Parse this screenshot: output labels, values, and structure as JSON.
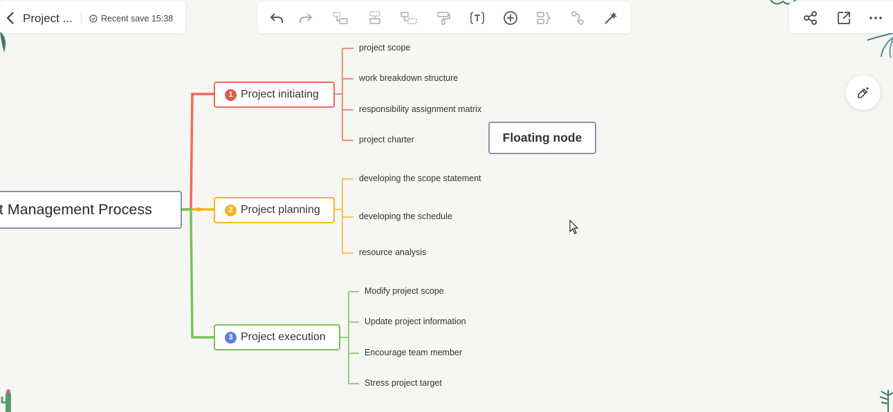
{
  "header": {
    "back_icon": "chevron-left-icon",
    "title": "Project ...",
    "save_status": "Recent save 15:38",
    "save_icon": "check-circle-icon"
  },
  "toolbar": {
    "icons": [
      "undo-icon",
      "redo-icon",
      "insert-topic-icon",
      "insert-subtopic-icon",
      "insert-floating-topic-icon",
      "format-painter-icon",
      "text-icon",
      "add-icon",
      "summary-icon",
      "relationship-icon",
      "magic-wand-icon"
    ]
  },
  "top_right": {
    "icons": [
      "share-icon",
      "export-icon",
      "more-icon"
    ]
  },
  "ai_button": {
    "icon": "ai-magic-pen-icon"
  },
  "mindmap": {
    "central": "ct Management Process",
    "floating": "Floating node",
    "branches": [
      {
        "number": "1",
        "label": "Project initiating",
        "color": "#ef6b57",
        "children": [
          "project scope",
          "work breakdown structure",
          "responsibility assignment matrix",
          "project charter"
        ]
      },
      {
        "number": "2",
        "label": "Project planning",
        "color": "#f5b324",
        "children": [
          "developing the scope statement",
          "developing the schedule",
          "resource analysis"
        ]
      },
      {
        "number": "3",
        "label": "Project execution",
        "color": "#78c25b",
        "badge_color": "#5b7fe0",
        "children": [
          "Modify project scope",
          "Update project information",
          "Encourage team member",
          "Stress project target"
        ]
      }
    ]
  }
}
